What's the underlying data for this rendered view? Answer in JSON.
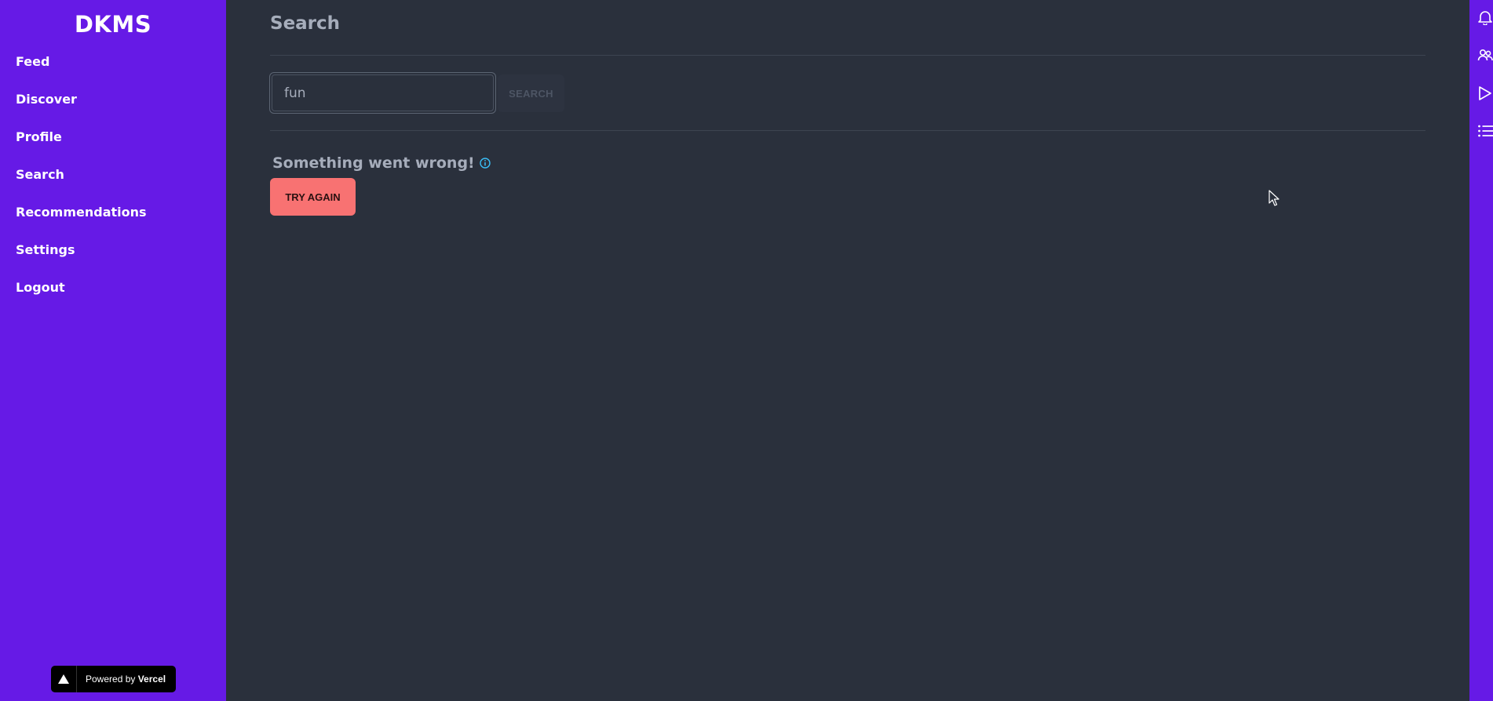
{
  "sidebar": {
    "brand": "DKMS",
    "items": [
      {
        "label": "Feed"
      },
      {
        "label": "Discover"
      },
      {
        "label": "Profile"
      },
      {
        "label": "Search"
      },
      {
        "label": "Recommendations"
      },
      {
        "label": "Settings"
      },
      {
        "label": "Logout"
      }
    ],
    "vercel_badge": {
      "prefix": "Powered by",
      "brand": "Vercel",
      "icon": "vercel-triangle-icon"
    }
  },
  "main": {
    "title": "Search",
    "search": {
      "value": "fun",
      "placeholder": "",
      "button_label": "SEARCH"
    },
    "error": {
      "message": "Something went wrong!",
      "icon": "info-icon",
      "retry_label": "TRY AGAIN"
    }
  },
  "right_toolbar": {
    "icons": [
      "bell-icon",
      "users-icon",
      "play-icon",
      "list-icon"
    ]
  },
  "colors": {
    "sidebar_bg": "#661ae6",
    "main_bg": "#2a303c",
    "text_muted": "#a6adbb",
    "error_button": "#f87272",
    "info_icon": "#3abff8"
  }
}
